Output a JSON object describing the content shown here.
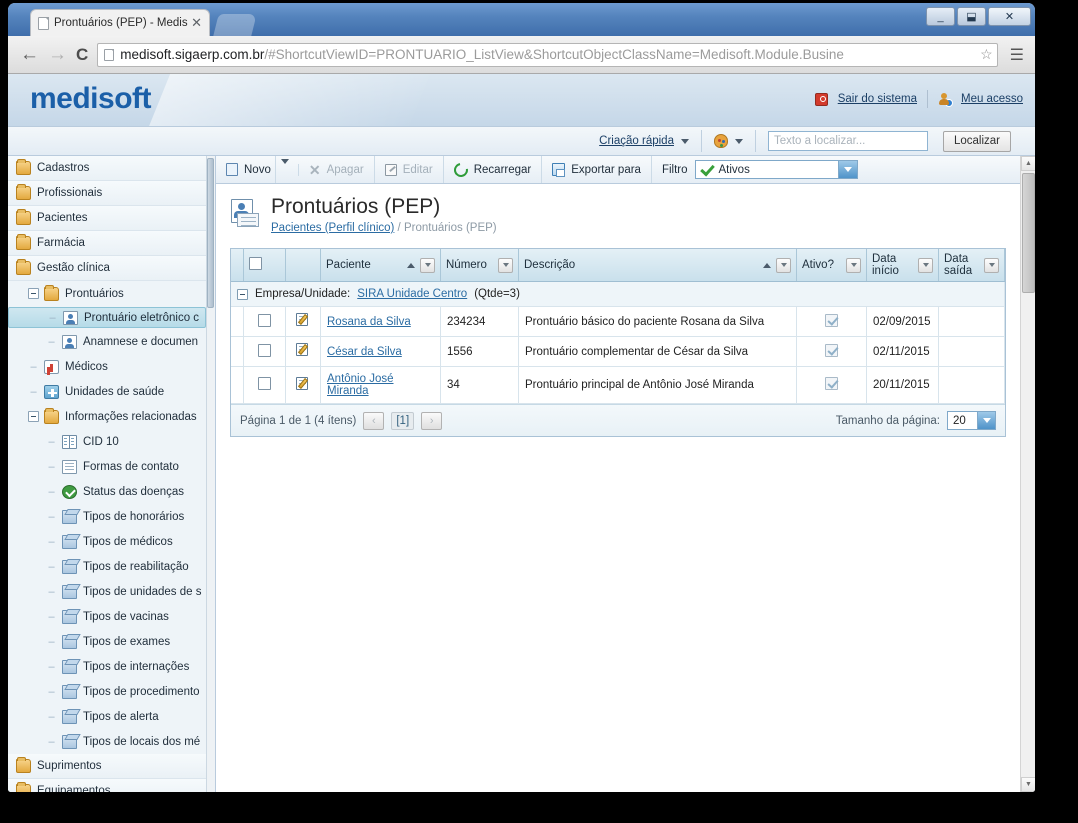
{
  "browser": {
    "tab_title": "Prontuários (PEP) - Medisoft",
    "tab_close": "✕",
    "url_host": "medisoft.sigaerp.com.br",
    "url_rest": "/#ShortcutViewID=PRONTUARIO_ListView&ShortcutObjectClassName=Medisoft.Module.Busine",
    "back_glyph": "←",
    "forward_glyph": "→",
    "reload_glyph": "C",
    "star_glyph": "☆",
    "menu_glyph": "☰",
    "win_minimize": "_",
    "win_maximize": "▢",
    "win_restore": "⬓",
    "win_close": "✕"
  },
  "header": {
    "logo": "medisoft",
    "logout_label": "Sair do sistema",
    "myaccess_label": "Meu acesso"
  },
  "quickbar": {
    "quickcreate_label": "Criação rápida",
    "search_placeholder": "Texto a localizar...",
    "search_value": "",
    "find_button": "Localizar"
  },
  "toolbar": {
    "new_label": "Novo",
    "delete_label": "Apagar",
    "edit_label": "Editar",
    "reload_label": "Recarregar",
    "export_label": "Exportar para",
    "filter_label": "Filtro",
    "filter_value": "Ativos"
  },
  "page": {
    "title": "Prontuários (PEP)",
    "breadcrumb_link": "Pacientes (Perfil clínico)",
    "breadcrumb_sep": " / ",
    "breadcrumb_current": "Prontuários (PEP)"
  },
  "grid": {
    "columns": [
      {
        "label": "Paciente",
        "sorted": "asc"
      },
      {
        "label": "Número",
        "sorted": ""
      },
      {
        "label": "Descrição",
        "sorted": "asc"
      },
      {
        "label": "Ativo?",
        "sorted": ""
      },
      {
        "label": "Data início",
        "line1": "Data",
        "line2": "início"
      },
      {
        "label": "Data saída",
        "line1": "Data",
        "line2": "saída"
      }
    ],
    "group": {
      "prefix": "Empresa/Unidade:",
      "link": "SIRA Unidade Centro",
      "count": "(Qtde=3)"
    },
    "rows": [
      {
        "paciente": "Rosana da Silva",
        "numero": "234234",
        "descricao": "Prontuário básico do paciente Rosana da Silva",
        "ativo": true,
        "data_inicio": "02/09/2015",
        "data_saida": ""
      },
      {
        "paciente": "César da Silva",
        "numero": "1556",
        "descricao": "Prontuário complementar de César da Silva",
        "ativo": true,
        "data_inicio": "02/11/2015",
        "data_saida": ""
      },
      {
        "paciente": "Antônio José Miranda",
        "numero": "34",
        "descricao": "Prontuário principal de Antônio José Miranda",
        "ativo": true,
        "data_inicio": "20/11/2015",
        "data_saida": ""
      }
    ]
  },
  "pager": {
    "summary": "Página 1 de 1 (4 ítens)",
    "prev": "‹",
    "current": "[1]",
    "next": "›",
    "pagesize_label": "Tamanho da página:",
    "pagesize_value": "20"
  },
  "sidebar": {
    "items": [
      {
        "label": "Cadastros",
        "icon": "folder-icon",
        "level": "top"
      },
      {
        "label": "Profissionais",
        "icon": "folder-icon",
        "level": "top"
      },
      {
        "label": "Pacientes",
        "icon": "folder-icon",
        "level": "top"
      },
      {
        "label": "Farmácia",
        "icon": "folder-icon",
        "level": "top"
      },
      {
        "label": "Gestão clínica",
        "icon": "folder-icon",
        "level": "top"
      },
      {
        "label": "Prontuários",
        "icon": "folder-icon",
        "level": "1"
      },
      {
        "label": "Prontuário eletrônico c",
        "icon": "person-card-icon",
        "level": "2",
        "selected": true
      },
      {
        "label": "Anamnese e documen",
        "icon": "person-card-icon",
        "level": "2"
      },
      {
        "label": "Médicos",
        "icon": "doctor-icon",
        "level": "1"
      },
      {
        "label": "Unidades de saúde",
        "icon": "hospital-icon",
        "level": "1"
      },
      {
        "label": "Informações relacionadas",
        "icon": "folder-icon",
        "level": "1"
      },
      {
        "label": "CID 10",
        "icon": "book-icon",
        "level": "2"
      },
      {
        "label": "Formas de contato",
        "icon": "doc-icon",
        "level": "2"
      },
      {
        "label": "Status das doenças",
        "icon": "check-icon",
        "level": "2"
      },
      {
        "label": "Tipos de honorários",
        "icon": "cube-icon",
        "level": "2"
      },
      {
        "label": "Tipos de médicos",
        "icon": "cube-icon",
        "level": "2"
      },
      {
        "label": "Tipos de reabilitação",
        "icon": "cube-icon",
        "level": "2"
      },
      {
        "label": "Tipos de unidades de s",
        "icon": "cube-icon",
        "level": "2"
      },
      {
        "label": "Tipos de vacinas",
        "icon": "cube-icon",
        "level": "2"
      },
      {
        "label": "Tipos de exames",
        "icon": "cube-icon",
        "level": "2"
      },
      {
        "label": "Tipos de internações",
        "icon": "cube-icon",
        "level": "2"
      },
      {
        "label": "Tipos de procedimento",
        "icon": "cube-icon",
        "level": "2"
      },
      {
        "label": "Tipos de alerta",
        "icon": "cube-icon",
        "level": "2"
      },
      {
        "label": "Tipos de locais dos mé",
        "icon": "cube-icon",
        "level": "2"
      },
      {
        "label": "Suprimentos",
        "icon": "folder-icon",
        "level": "top"
      },
      {
        "label": "Equipamentos",
        "icon": "folder-icon",
        "level": "top"
      }
    ]
  },
  "colors": {
    "brand_blue": "#1b5fa8",
    "link_blue": "#2b6ca3",
    "header_gradient_top": "#dbe7f1",
    "grid_header": "#c9e0ec",
    "selection": "#b6dbe8"
  }
}
